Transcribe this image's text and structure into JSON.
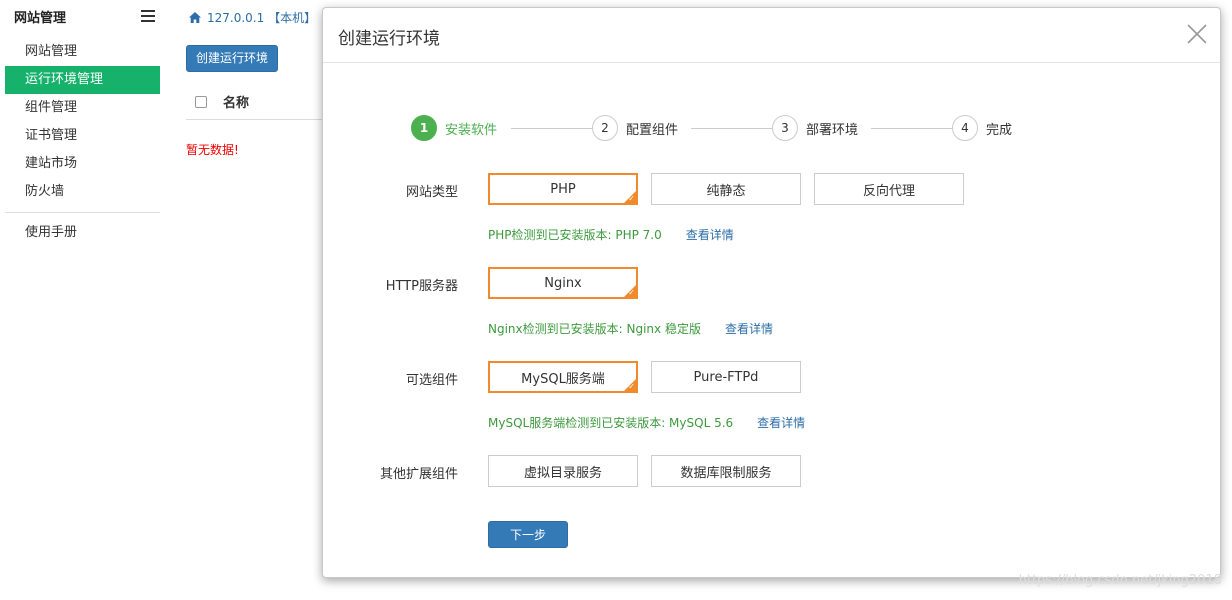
{
  "sidebar": {
    "title": "网站管理",
    "items": [
      {
        "label": "网站管理",
        "active": false
      },
      {
        "label": "运行环境管理",
        "active": true
      },
      {
        "label": "组件管理",
        "active": false
      },
      {
        "label": "证书管理",
        "active": false
      },
      {
        "label": "建站市场",
        "active": false
      },
      {
        "label": "防火墙",
        "active": false
      }
    ],
    "footer_items": [
      {
        "label": "使用手册"
      }
    ]
  },
  "main": {
    "breadcrumb": "127.0.0.1 【本机】",
    "create_button": "创建运行环境",
    "table": {
      "header_name": "名称"
    },
    "empty_text": "暂无数据!"
  },
  "modal": {
    "title": "创建运行环境",
    "steps": [
      {
        "num": "1",
        "label": "安装软件",
        "active": true
      },
      {
        "num": "2",
        "label": "配置组件",
        "active": false
      },
      {
        "num": "3",
        "label": "部署环境",
        "active": false
      },
      {
        "num": "4",
        "label": "完成",
        "active": false
      }
    ],
    "rows": {
      "site_type": {
        "label": "网站类型",
        "options": [
          {
            "label": "PHP",
            "selected": true
          },
          {
            "label": "纯静态",
            "selected": false
          },
          {
            "label": "反向代理",
            "selected": false
          }
        ],
        "hint": "PHP检测到已安装版本: PHP 7.0",
        "hint_link": "查看详情"
      },
      "http_server": {
        "label": "HTTP服务器",
        "options": [
          {
            "label": "Nginx",
            "selected": true
          }
        ],
        "hint": "Nginx检测到已安装版本: Nginx 稳定版",
        "hint_link": "查看详情"
      },
      "optional": {
        "label": "可选组件",
        "options": [
          {
            "label": "MySQL服务端",
            "selected": true
          },
          {
            "label": "Pure-FTPd",
            "selected": false
          }
        ],
        "hint": "MySQL服务端检测到已安装版本: MySQL 5.6",
        "hint_link": "查看详情"
      },
      "extensions": {
        "label": "其他扩展组件",
        "options": [
          {
            "label": "虚拟目录服务",
            "selected": false
          },
          {
            "label": "数据库限制服务",
            "selected": false
          }
        ]
      }
    },
    "next_button": "下一步"
  },
  "watermark": "https://blog.csdn.net/jking2018",
  "colors": {
    "accent_green": "#16b26c",
    "primary_blue": "#337ab7",
    "selected_orange": "#f08a2c",
    "hint_green": "#3d9a3d"
  }
}
